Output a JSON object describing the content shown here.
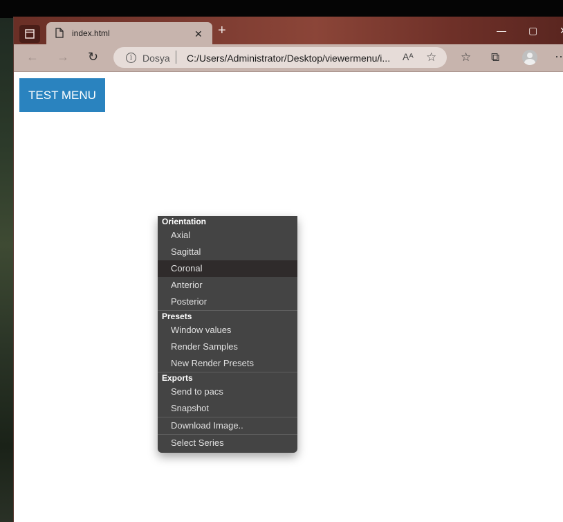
{
  "browser": {
    "tab_title": "index.html",
    "address_protocol": "Dosya",
    "address_url": "C:/Users/Administrator/Desktop/viewermenu/i...",
    "read_aloud": "Aᴬ",
    "buttons": {
      "back_icon": "←",
      "forward_icon": "→",
      "refresh_icon": "↻",
      "new_tab_icon": "+",
      "close_tab_icon": "✕",
      "minimize_icon": "—",
      "maximize_icon": "▢",
      "close_window_icon": "✕",
      "favorite_icon": "☆",
      "favorites_icon": "☆",
      "collections_icon": "⧉",
      "more_icon": "···"
    }
  },
  "page": {
    "test_menu_label": "TEST MENU"
  },
  "context_menu": {
    "sections": [
      {
        "header": "Orientation",
        "items": [
          "Axial",
          "Sagittal",
          "Coronal",
          "Anterior",
          "Posterior"
        ]
      },
      {
        "header": "Presets",
        "items": [
          "Window values",
          "Render Samples",
          "New Render Presets"
        ]
      },
      {
        "header": "Exports",
        "items": [
          "Send to pacs",
          "Snapshot"
        ]
      }
    ],
    "extra_items": [
      "Download Image..",
      "Select Series"
    ],
    "highlighted_item": "Coronal"
  },
  "colors": {
    "accent_button": "#2a83bf",
    "menu_background": "#444444",
    "menu_highlight": "#2f2b2b"
  }
}
